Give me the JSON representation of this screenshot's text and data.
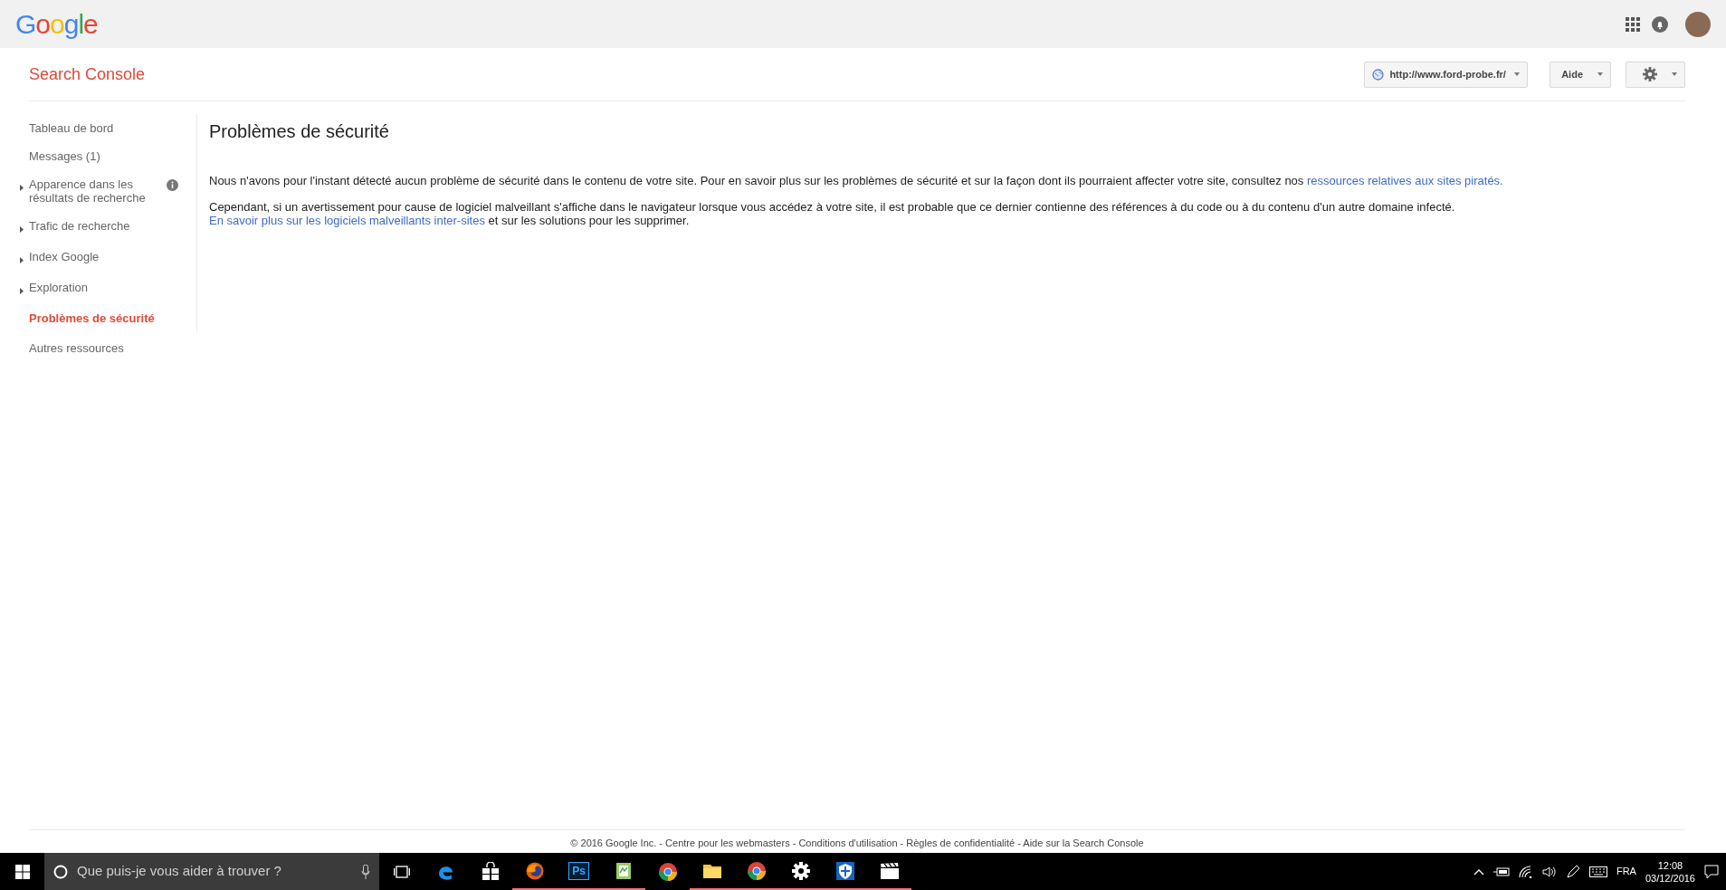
{
  "header": {
    "logo": "Google"
  },
  "product": {
    "title": "Search Console",
    "site_button": "http://www.ford-probe.fr/",
    "help_button": "Aide"
  },
  "sidebar": {
    "items": [
      {
        "label": "Tableau de bord",
        "expandable": false,
        "info": false,
        "selected": false
      },
      {
        "label": "Messages (1)",
        "expandable": false,
        "info": false,
        "selected": false
      },
      {
        "label": "Apparence dans les résultats de recherche",
        "expandable": true,
        "info": true,
        "selected": false
      },
      {
        "label": "Trafic de recherche",
        "expandable": true,
        "info": false,
        "selected": false
      },
      {
        "label": "Index Google",
        "expandable": true,
        "info": false,
        "selected": false
      },
      {
        "label": "Exploration",
        "expandable": true,
        "info": false,
        "selected": false
      },
      {
        "label": "Problèmes de sécurité",
        "expandable": false,
        "info": false,
        "selected": true
      },
      {
        "label": "Autres ressources",
        "expandable": false,
        "info": false,
        "selected": false
      }
    ]
  },
  "content": {
    "title": "Problèmes de sécurité",
    "paragraphs": [
      {
        "parts": [
          {
            "kind": "text",
            "text": "Nous n'avons pour l'instant détecté aucun problème de sécurité dans le contenu de votre site. Pour en savoir plus sur les problèmes de sécurité et sur la façon dont ils pourraient affecter votre site, consultez nos "
          },
          {
            "kind": "link",
            "text": "ressources relatives aux sites piratés."
          }
        ]
      },
      {
        "parts": [
          {
            "kind": "text",
            "text": "Cependant, si un avertissement pour cause de logiciel malveillant s'affiche dans le navigateur lorsque vous accédez à votre site, il est probable que ce dernier contienne des références à du code ou à du contenu d'un autre domaine infecté. "
          },
          {
            "kind": "link",
            "text": "En savoir plus sur les logiciels malveillants inter-sites"
          },
          {
            "kind": "text",
            "text": " et sur les solutions pour les supprimer."
          }
        ]
      }
    ]
  },
  "footer": {
    "text": "© 2016 Google Inc. - Centre pour les webmasters - Conditions d'utilisation - Règles de confidentialité - Aide sur la Search Console"
  },
  "taskbar": {
    "search": {
      "placeholder": "Que puis-je vous aider à trouver ?"
    },
    "apps": [
      {
        "kind": "edge",
        "running": false
      },
      {
        "kind": "store",
        "running": false
      },
      {
        "kind": "firefox",
        "running": true
      },
      {
        "kind": "ps",
        "label": "Ps",
        "running": true
      },
      {
        "kind": "notepad",
        "running": true
      },
      {
        "kind": "chrome",
        "running": false
      },
      {
        "kind": "explorer",
        "running": true
      },
      {
        "kind": "chrome",
        "running": true
      },
      {
        "kind": "gear",
        "running": true
      },
      {
        "kind": "shield",
        "running": true
      },
      {
        "kind": "clapper",
        "running": true
      }
    ],
    "language": "FRA",
    "time": "12:08",
    "date": "03/12/2016"
  }
}
